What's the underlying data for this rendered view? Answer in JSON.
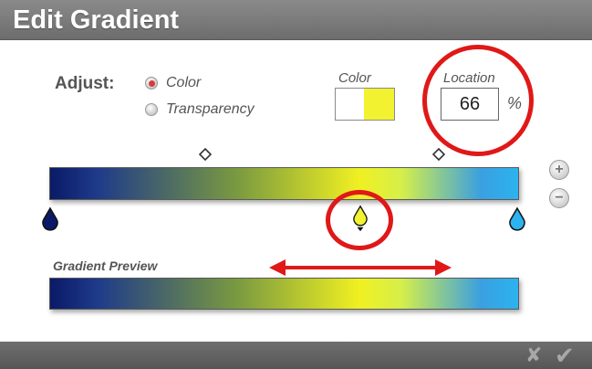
{
  "window": {
    "title": "Edit Gradient"
  },
  "adjust": {
    "label": "Adjust:",
    "options": [
      {
        "label": "Color",
        "selected": true
      },
      {
        "label": "Transparency",
        "selected": false
      }
    ]
  },
  "color": {
    "label": "Color",
    "swatch_left": "#ffffff",
    "swatch_right": "#f2f231"
  },
  "location": {
    "label": "Location",
    "value": "66",
    "unit": "%"
  },
  "gradient": {
    "stops": [
      {
        "location_pct": 0,
        "color": "#0a1a66"
      },
      {
        "location_pct": 66,
        "color": "#f2f231",
        "selected": true
      },
      {
        "location_pct": 100,
        "color": "#2bb3ef"
      }
    ],
    "midpoints_pct": [
      33,
      83
    ]
  },
  "buttons": {
    "add": "+",
    "remove": "−"
  },
  "preview": {
    "label": "Gradient Preview"
  },
  "footer": {
    "cancel": "✘",
    "ok": "✔"
  },
  "colors": {
    "annotation_red": "#e01818",
    "accent": "#d93a3a"
  }
}
